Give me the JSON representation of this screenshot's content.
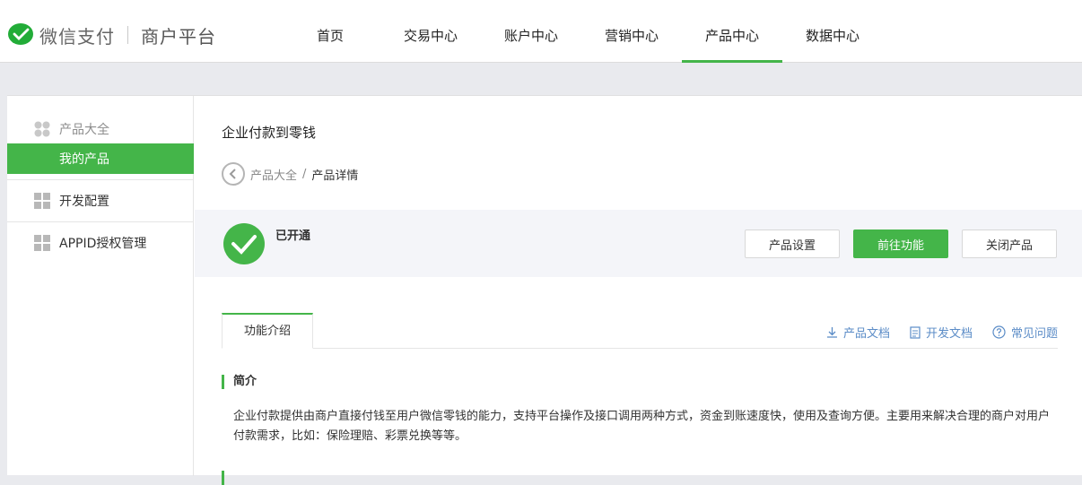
{
  "header": {
    "brand": "微信支付",
    "subtitle": "商户平台",
    "nav": [
      {
        "label": "首页",
        "active": false
      },
      {
        "label": "交易中心",
        "active": false
      },
      {
        "label": "账户中心",
        "active": false
      },
      {
        "label": "营销中心",
        "active": false
      },
      {
        "label": "产品中心",
        "active": true
      },
      {
        "label": "数据中心",
        "active": false
      }
    ]
  },
  "sidebar": {
    "group_title": "产品大全",
    "active_item": "我的产品",
    "items": [
      "开发配置",
      "APPID授权管理"
    ]
  },
  "main": {
    "title": "企业付款到零钱",
    "breadcrumb": {
      "parent": "产品大全",
      "separator": "/",
      "current": "产品详情"
    },
    "status": {
      "text": "已开通"
    },
    "buttons": {
      "settings": "产品设置",
      "goto": "前往功能",
      "close": "关闭产品"
    },
    "tab": "功能介绍",
    "doc_links": {
      "product_doc": "产品文档",
      "dev_doc": "开发文档",
      "faq": "常见问题"
    },
    "intro": {
      "heading": "简介",
      "body": "企业付款提供由商户直接付钱至用户微信零钱的能力，支持平台操作及接口调用两种方式，资金到账速度快，使用及查询方便。主要用来解决合理的商户对用户付款需求，比如：保险理赔、彩票兑换等等。"
    }
  },
  "colors": {
    "brand_green": "#44b549",
    "link_blue": "#5b8cc7"
  }
}
